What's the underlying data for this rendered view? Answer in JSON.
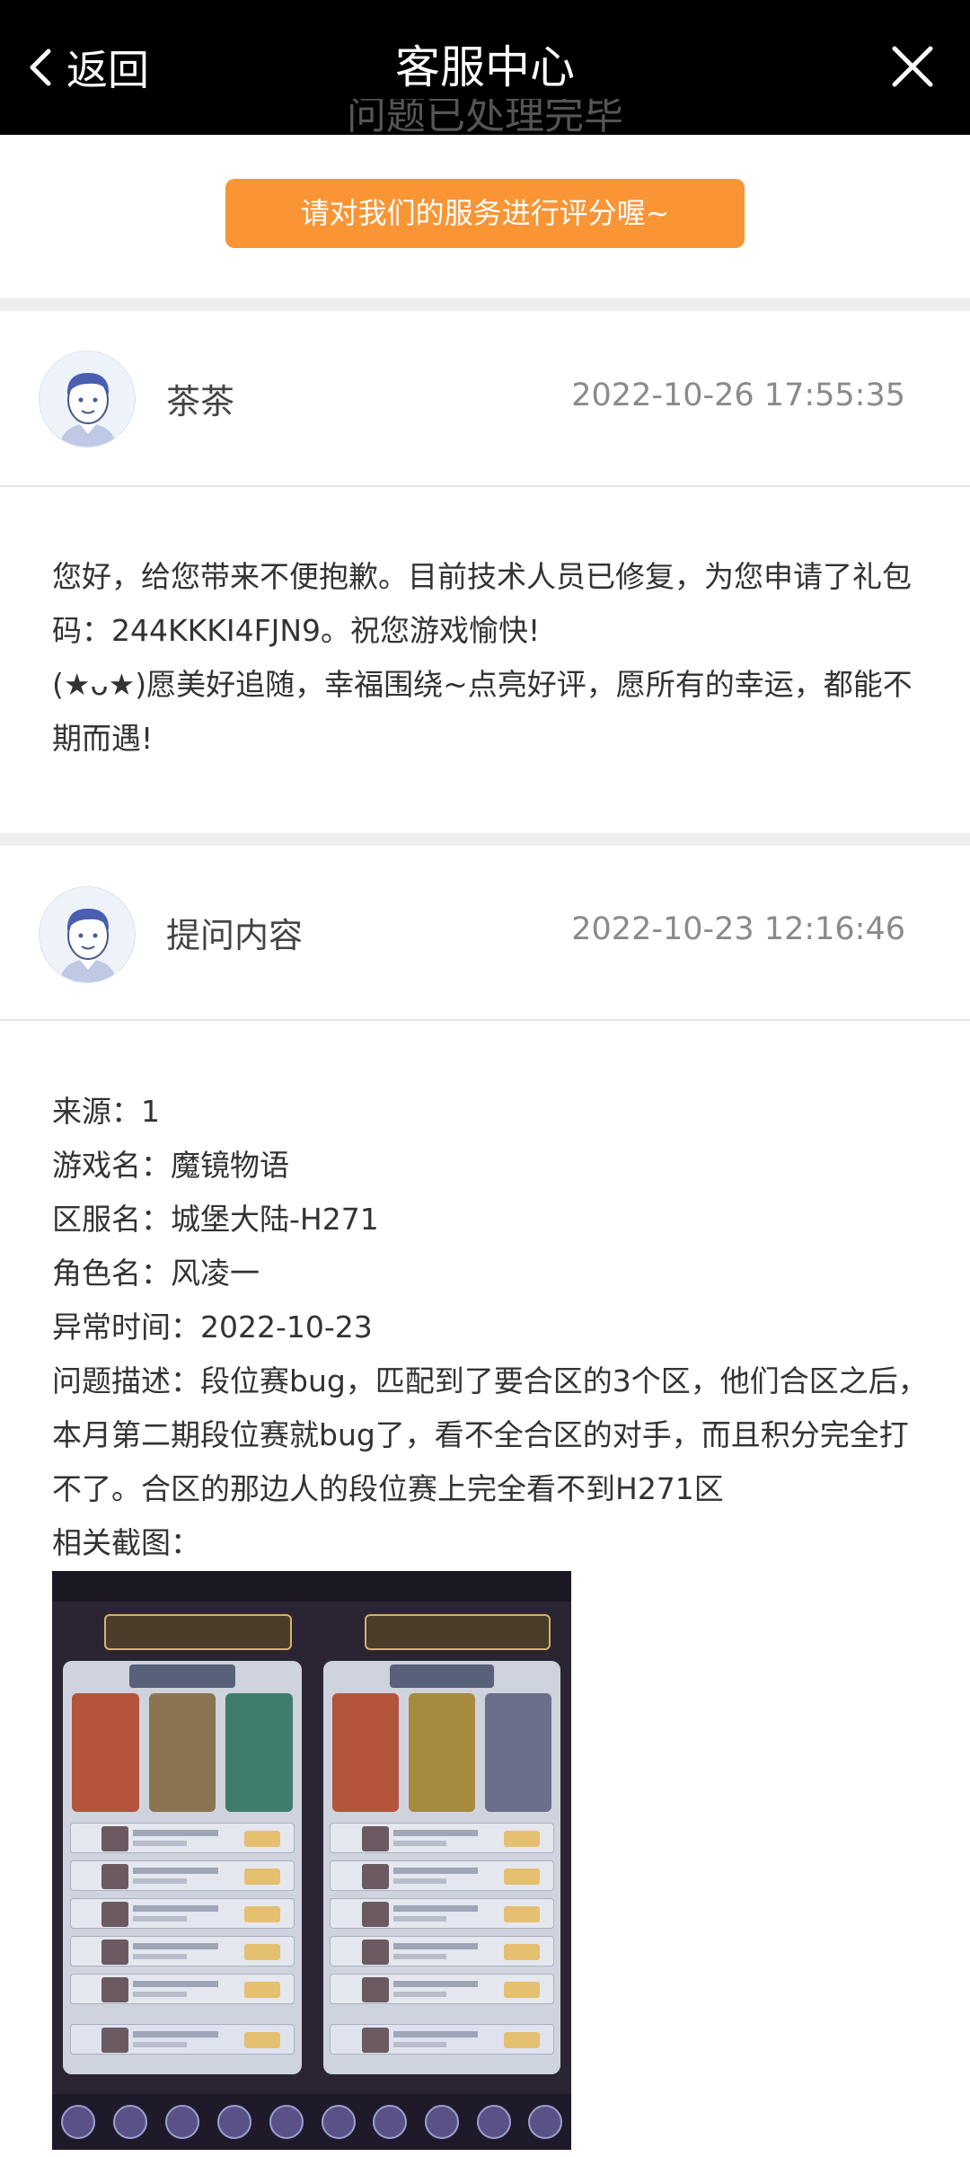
{
  "header": {
    "back_label": "返回",
    "title": "客服中心",
    "icons": {
      "back": "chevron-left-icon",
      "close": "close-icon"
    }
  },
  "top": {
    "partial_text": "问题已处理完毕",
    "rate_button": "请对我们的服务进行评分喔~"
  },
  "reply": {
    "name": "茶茶",
    "time": "2022-10-26 17:55:35",
    "paragraphs": [
      "您好，给您带来不便抱歉。目前技术人员已修复，为您申请了礼包码：244KKKI4FJN9。祝您游戏愉快!",
      "(★ᴗ★)愿美好追随，幸福围绕~点亮好评，愿所有的幸运，都能不期而遇!"
    ]
  },
  "question": {
    "name": "提问内容",
    "time": "2022-10-23 12:16:46",
    "fields": {
      "source": "来源：1",
      "game": "游戏名：魔镜物语",
      "server": "区服名：城堡大陆-H271",
      "role": "角色名：风凌一",
      "time": "异常时间：2022-10-23",
      "desc": "问题描述：段位赛bug，匹配到了要合区的3个区，他们合区之后，本月第二期段位赛就bug了，看不全合区的对手，而且积分完全打不了。合区的那边人的段位赛上完全看不到H271区",
      "screens": "相关截图："
    }
  },
  "colors": {
    "topbar": "#000000",
    "accent": "#f99534",
    "separator": "#eeeeee",
    "time": "#8a8a8a"
  }
}
